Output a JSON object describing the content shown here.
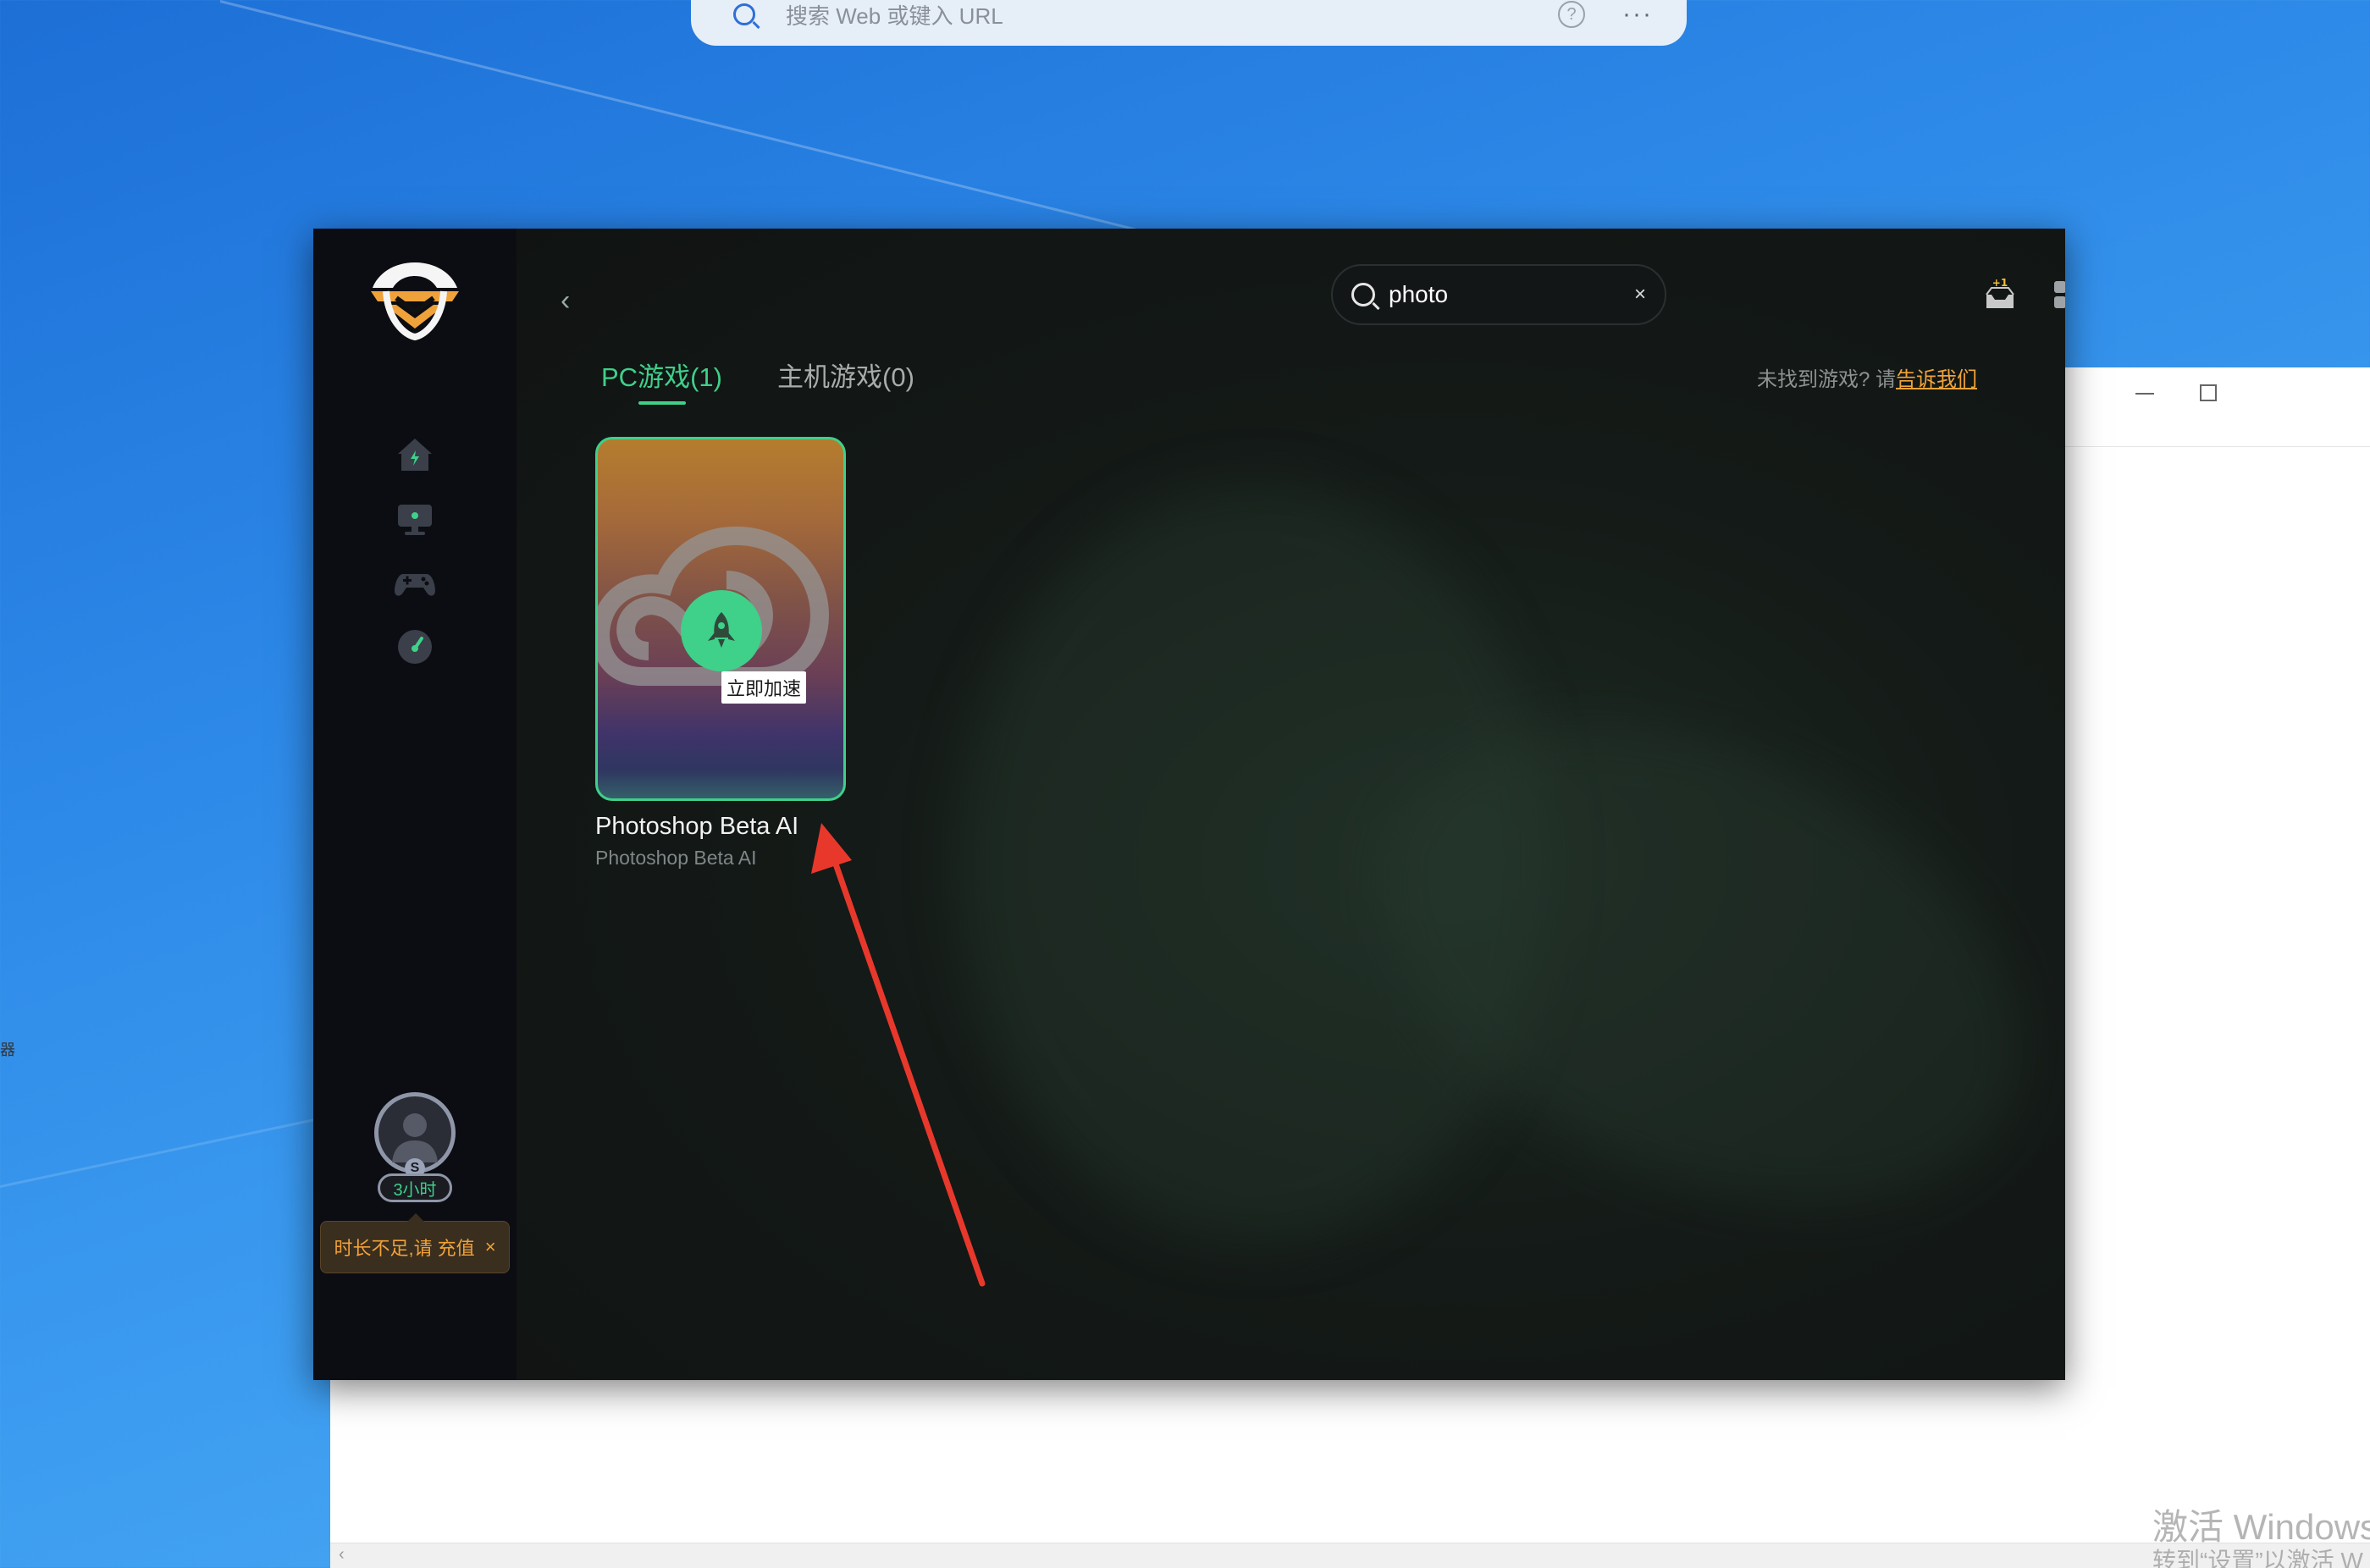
{
  "browser": {
    "search_placeholder": "搜索 Web 或键入 URL",
    "help_icon": "question-circle-icon",
    "more_icon": "more-dots-icon"
  },
  "desktop": {
    "activate_title": "激活 Windows",
    "activate_sub": "转到“设置”以激活 W",
    "edge_char": "器"
  },
  "app": {
    "sidebar": {
      "nav": [
        "home-icon",
        "monitor-icon",
        "gamepad-icon",
        "speedometer-icon"
      ],
      "user": {
        "level_badge": "S",
        "hours": "3小时"
      },
      "recharge_tip": "时长不足,请 充值",
      "recharge_close": "×"
    },
    "header": {
      "search_value": "photo",
      "clear_label": "×",
      "close_label": "✕",
      "back_label": "‹"
    },
    "tabs": [
      {
        "label": "PC游戏(1)",
        "active": true
      },
      {
        "label": "主机游戏(0)",
        "active": false
      }
    ],
    "not_found_prefix": "未找到游戏? 请",
    "not_found_link": "告诉我们",
    "games": [
      {
        "title": "Photoshop Beta AI",
        "subtitle": "Photoshop Beta AI",
        "action": "立即加速"
      }
    ],
    "accent": "#3fd08a",
    "warning": "#f0a23a"
  }
}
